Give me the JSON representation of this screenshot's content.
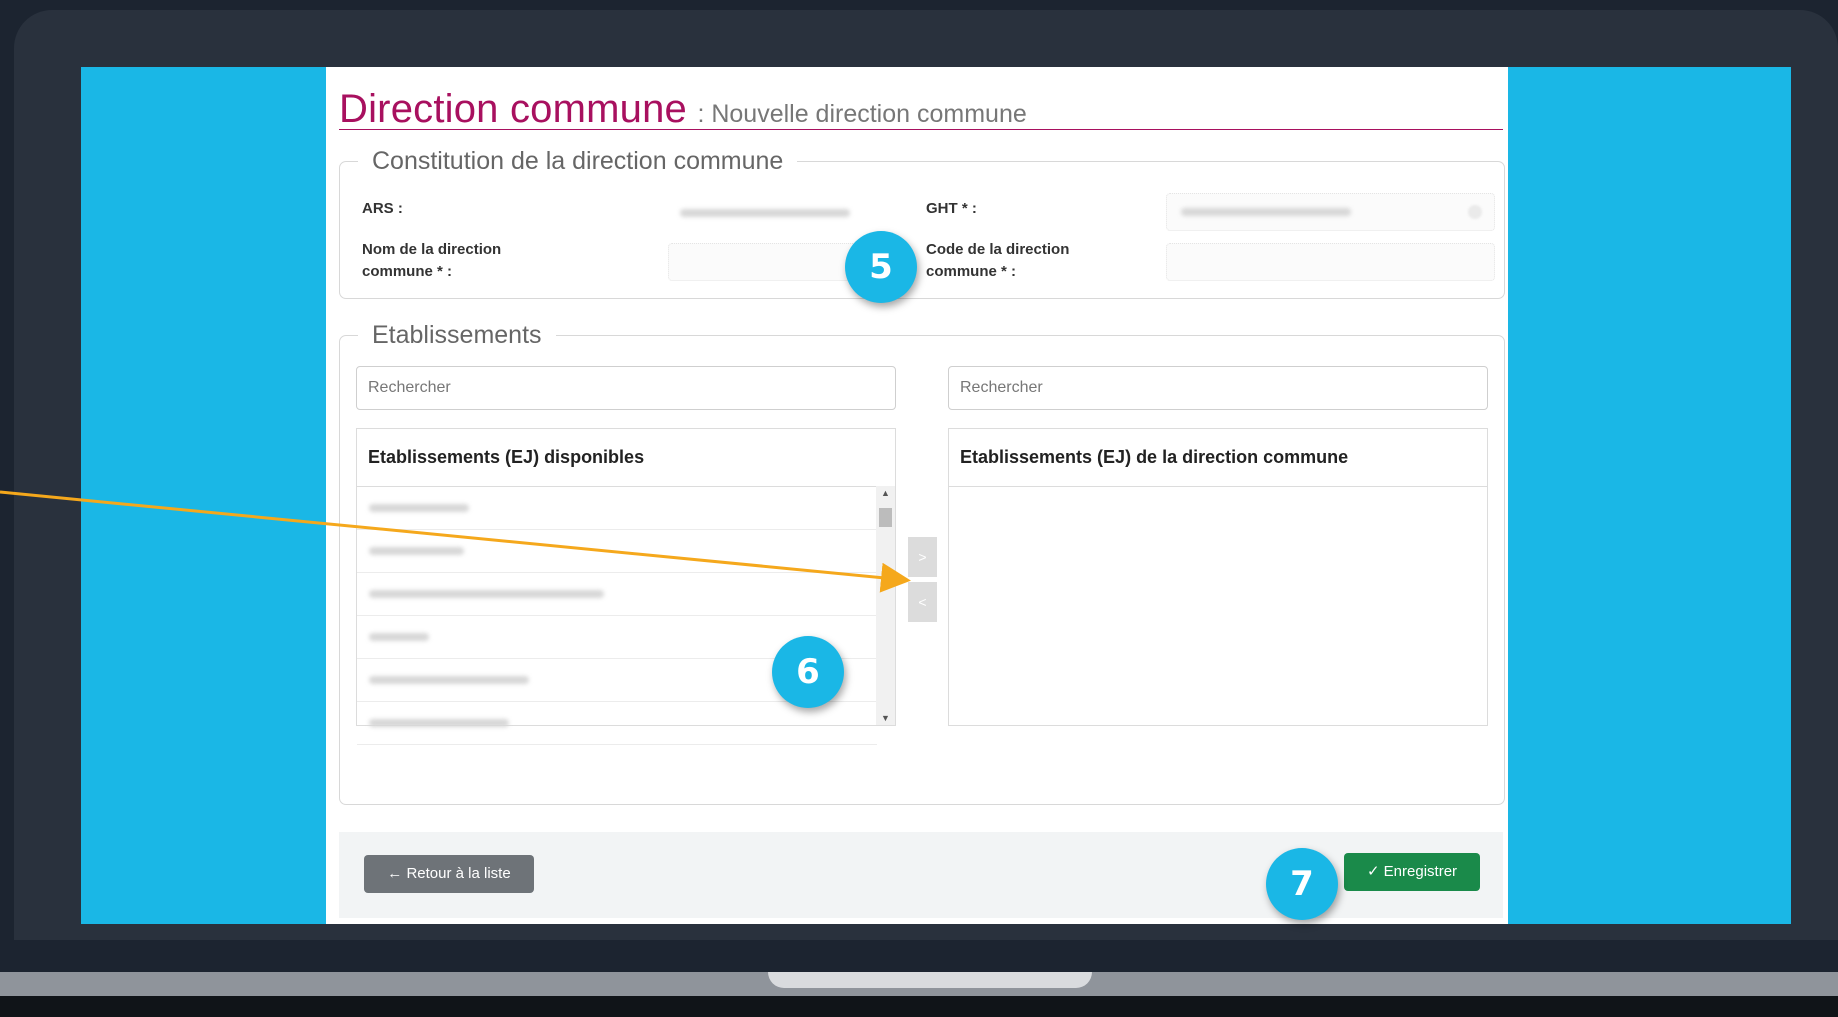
{
  "colors": {
    "accent": "#a8105f",
    "screen_background": "#1ab7e6",
    "save_button": "#1a8a4a",
    "back_button": "#6e7378",
    "annotation_arrow": "#f5a81c"
  },
  "header": {
    "title": "Direction commune",
    "subtitle": ": Nouvelle direction commune"
  },
  "constitution": {
    "legend": "Constitution de la direction commune",
    "ars_label": "ARS :",
    "ght_label": "GHT * :",
    "nom_label_line1": "Nom de la direction",
    "nom_label_line2": "commune * :",
    "code_label_line1": "Code de la direction",
    "code_label_line2": "commune * :"
  },
  "etablissements": {
    "legend": "Etablissements",
    "search_placeholder_left": "Rechercher",
    "search_placeholder_right": "Rechercher",
    "available_header": "Etablissements (EJ) disponibles",
    "selected_header": "Etablissements (EJ) de la direction commune",
    "move_right_label": ">",
    "move_left_label": "<"
  },
  "footer": {
    "back_label": "← Retour à la liste",
    "save_label": "✓ Enregistrer"
  },
  "annotations": {
    "badge_5": "5",
    "badge_6": "6",
    "badge_7": "7"
  }
}
